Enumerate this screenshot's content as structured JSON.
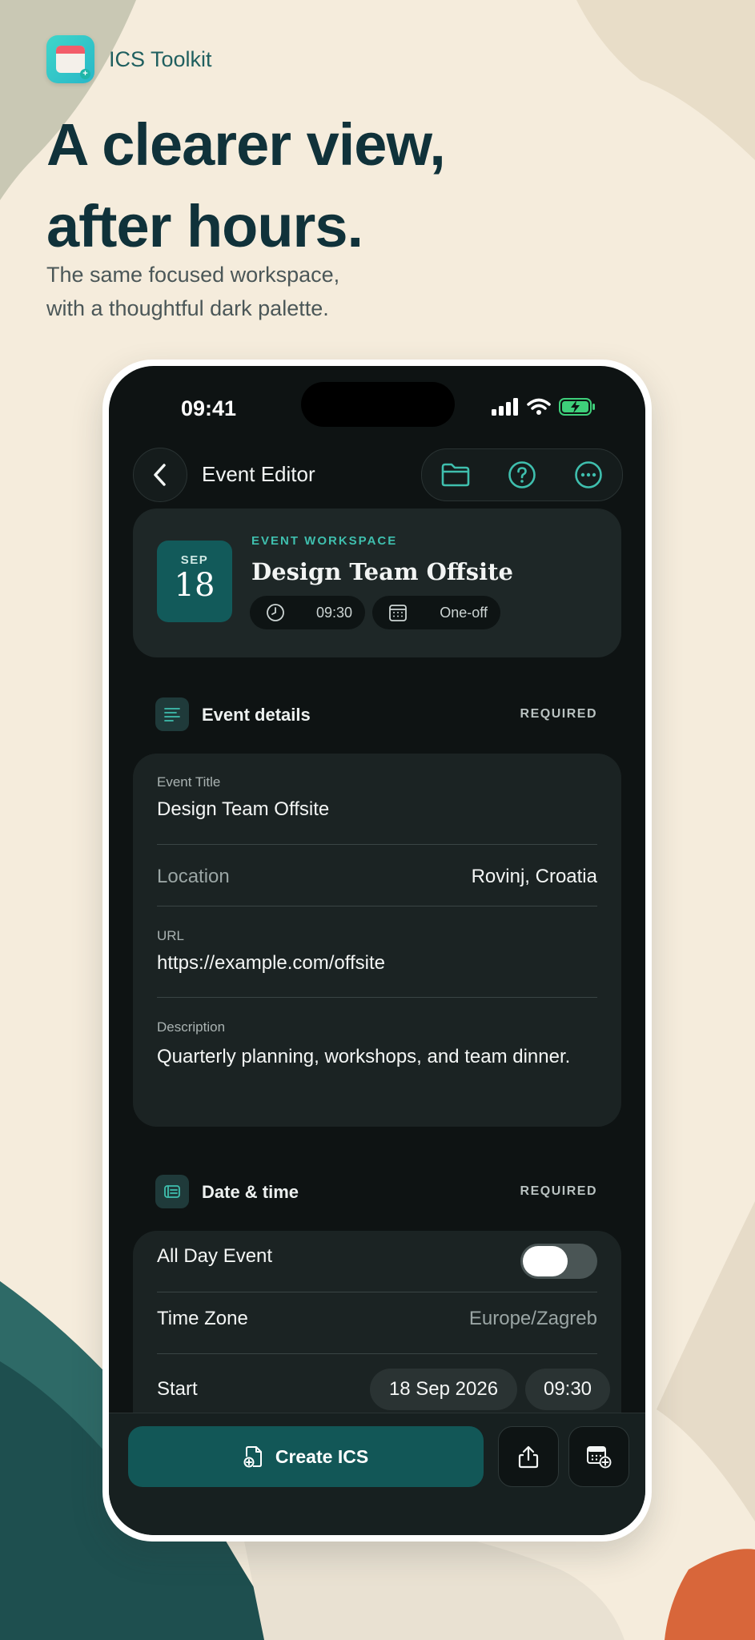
{
  "promo": {
    "app_name": "ICS Toolkit",
    "headline_line1": "A clearer view,",
    "headline_line2": "after hours.",
    "subline_line1": "The same focused workspace,",
    "subline_line2": "with a thoughtful dark palette."
  },
  "status_bar": {
    "time": "09:41"
  },
  "nav": {
    "title": "Event Editor",
    "icons": [
      "chevron-left-icon",
      "folder-icon",
      "help-circle-icon",
      "more-horizontal-icon"
    ]
  },
  "hero": {
    "month": "SEP",
    "day": "18",
    "eyebrow": "EVENT WORKSPACE",
    "title": "Design Team Offsite",
    "time_chip": "09:30",
    "repeat_chip": "One-off"
  },
  "event_details": {
    "label": "Event details",
    "badge": "REQUIRED",
    "title_caption": "Event Title",
    "title_value": "Design Team Offsite",
    "location_label": "Location",
    "location_value": "Rovinj, Croatia",
    "url_caption": "URL",
    "url_value": "https://example.com/offsite",
    "description_caption": "Description",
    "description_value": "Quarterly planning, workshops, and team dinner."
  },
  "date_time": {
    "label": "Date & time",
    "badge": "REQUIRED",
    "all_day_label": "All Day Event",
    "all_day_on": false,
    "timezone_label": "Time Zone",
    "timezone_value": "Europe/Zagreb",
    "start_label": "Start",
    "start_date": "18 Sep 2026",
    "start_time": "09:30"
  },
  "actions": {
    "create_label": "Create ICS",
    "icons": [
      "share-icon",
      "calendar-add-icon"
    ]
  },
  "colors": {
    "accent": "#3fbfae",
    "primary_button": "#125757",
    "screen_bg": "#0e1313",
    "card_bg": "#1b2323",
    "headline": "#10323a"
  }
}
